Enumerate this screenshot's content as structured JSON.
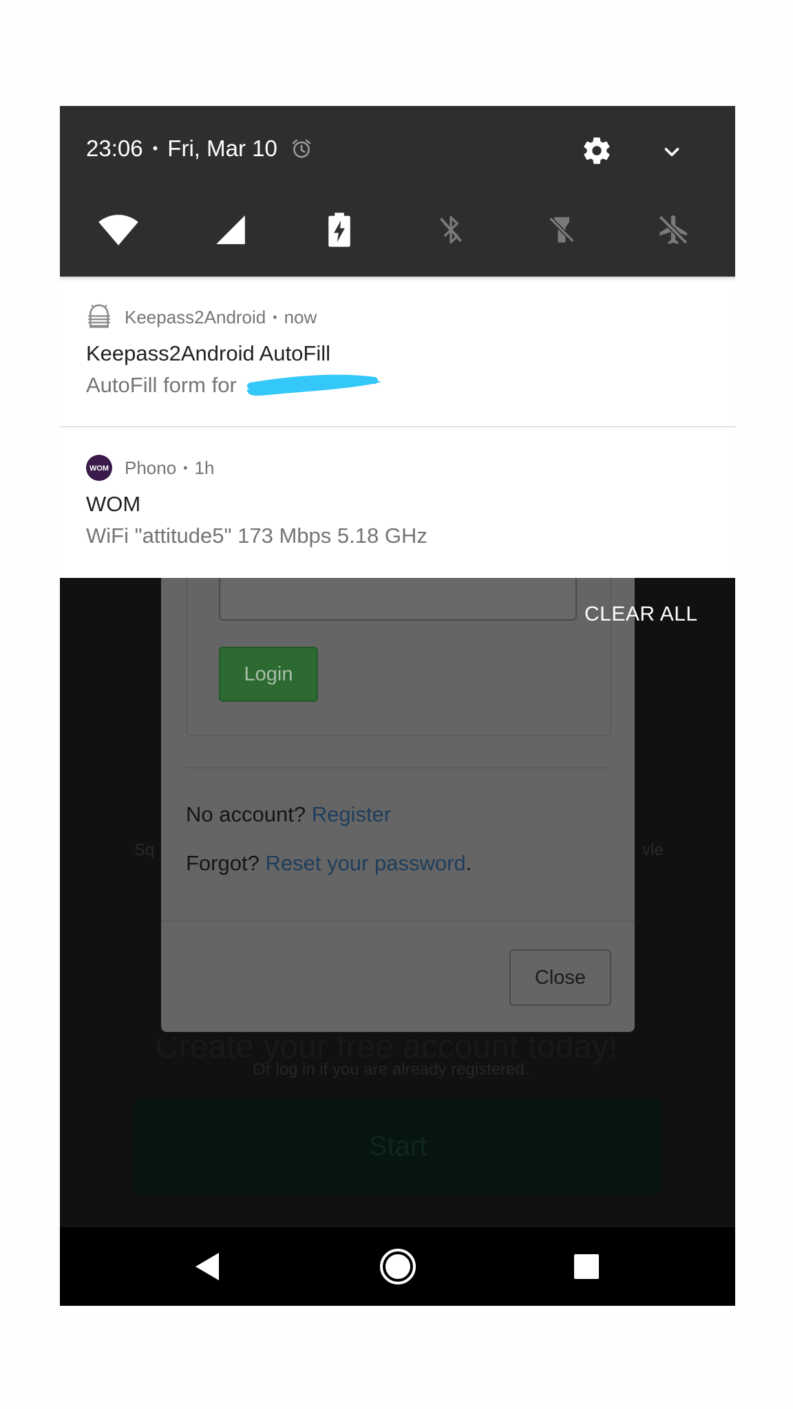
{
  "status": {
    "time": "23:06",
    "date": "Fri, Mar 10"
  },
  "icons": {
    "alarm": "alarm-clock-icon",
    "settings": "gear-icon",
    "expand": "chevron-down-icon",
    "tiles": [
      "wifi-icon",
      "cellular-signal-icon",
      "battery-saver-icon",
      "bluetooth-off-icon",
      "flashlight-off-icon",
      "airplane-mode-off-icon"
    ]
  },
  "notifications": [
    {
      "app": "Keepass2Android",
      "age": "now",
      "title": "Keepass2Android AutoFill",
      "text": "AutoFill form for"
    },
    {
      "app": "Phono",
      "age": "1h",
      "app_badge": "WOM",
      "title": "WOM",
      "text": "WiFi \"attitude5\" 173 Mbps 5.18 GHz"
    }
  ],
  "clear_all": "CLEAR ALL",
  "page": {
    "login_button": "Login",
    "no_account_prefix": "No account?",
    "register_link": "Register",
    "forgot_prefix": "Forgot?",
    "reset_link": "Reset your password",
    "reset_suffix": ".",
    "close_button": "Close",
    "bg_left_fragment": "Sq",
    "bg_right_fragment": "vle",
    "bg_heading": "Create your free account today!",
    "bg_subtitle": "Or log in if you are already registered.",
    "start_button": "Start"
  },
  "colors": {
    "shade": "#2e2e2e",
    "redaction": "#33c8f8",
    "wom_badge": "#3a1a4a"
  }
}
